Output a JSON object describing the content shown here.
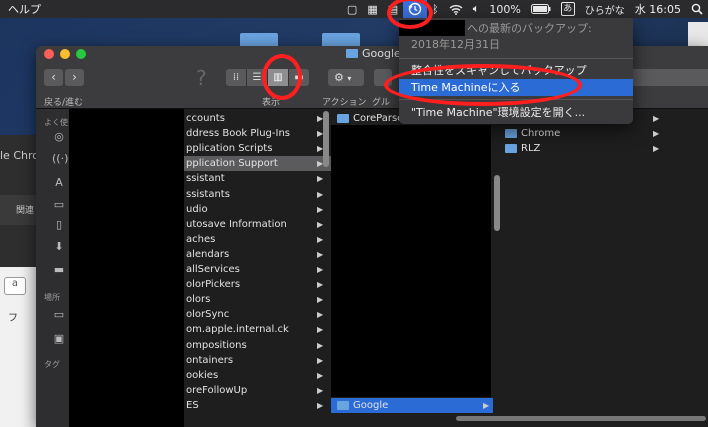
{
  "menubar": {
    "help": "ヘルプ",
    "battery": "100%",
    "ime_char": "あ",
    "ime_label": "ひらがな",
    "clock": "水 16:05"
  },
  "desktop": {
    "bg_window_title_fragment": "le Chro",
    "bg_window_tool_label": "関連",
    "bg_window_key": "a",
    "bg_window_key2": "フ"
  },
  "finder": {
    "title": "Google",
    "back_forward_label": "戻る/進む",
    "view_label": "表示",
    "action_label": "アクション",
    "group_label": "グル",
    "sidebar": {
      "favorites_header": "よく使う項目",
      "locations_header": "場所",
      "tags_header": "タグ"
    },
    "column1": [
      "ccounts",
      "ddress Book Plug-Ins",
      "pplication Scripts",
      "pplication Support",
      "ssistant",
      "ssistants",
      "udio",
      "utosave Information",
      "aches",
      "alendars",
      "allServices",
      "olorPickers",
      "olors",
      "olorSync",
      "om.apple.internal.ck",
      "ompositions",
      "ontainers",
      "ookies",
      "oreFollowUp",
      "ES"
    ],
    "column2_top": "CoreParse",
    "column2_selected": "Google",
    "column3": [
      "Chrome",
      "RLZ"
    ]
  },
  "time_machine_menu": {
    "latest_backup_label": "への最新のバックアップ:",
    "latest_backup_date": "2018年12月31日",
    "scan_item": "整合性をスキャンしてバックアップ",
    "enter_item": "Time Machineに入る",
    "prefs_item": "\"Time Machine\"環境設定を開く..."
  },
  "colors": {
    "highlight": "#2b6bd6",
    "annotation": "#ff1f1f"
  }
}
